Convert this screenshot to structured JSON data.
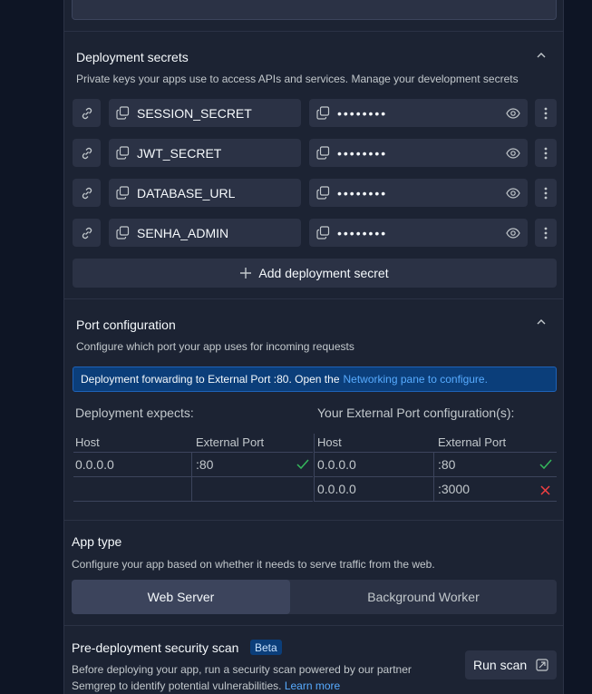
{
  "secrets": {
    "title": "Deployment secrets",
    "subtitle": "Private keys your apps use to access APIs and services. Manage your development secrets",
    "rows": [
      {
        "key": "SESSION_SECRET",
        "value": "••••••••"
      },
      {
        "key": "JWT_SECRET",
        "value": "••••••••"
      },
      {
        "key": "DATABASE_URL",
        "value": "••••••••"
      },
      {
        "key": "SENHA_ADMIN",
        "value": "••••••••"
      }
    ],
    "add_label": "Add deployment secret"
  },
  "ports": {
    "title": "Port configuration",
    "subtitle": "Configure which port your app uses for incoming requests",
    "banner_text": "Deployment forwarding to External Port :80. Open the",
    "banner_link": "Networking pane to configure.",
    "expects_label": "Deployment expects:",
    "external_label": "Your External Port configuration(s):",
    "col_host": "Host",
    "col_external": "External Port",
    "expects_rows": [
      {
        "host": "0.0.0.0",
        "port": ":80",
        "status": "ok"
      }
    ],
    "external_rows": [
      {
        "host": "0.0.0.0",
        "port": ":80",
        "status": "ok"
      },
      {
        "host": "0.0.0.0",
        "port": ":3000",
        "status": "error"
      }
    ]
  },
  "app_type": {
    "title": "App type",
    "subtitle": "Configure your app based on whether it needs to serve traffic from the web.",
    "options": [
      "Web Server",
      "Background Worker"
    ],
    "selected": "Web Server"
  },
  "scan": {
    "title": "Pre-deployment security scan",
    "badge": "Beta",
    "desc_line1": "Before deploying your app, run a security scan powered by our partner",
    "desc_line2": "Semgrep to identify potential vulnerabilities.",
    "learn_more": "Learn more",
    "run_label": "Run scan"
  },
  "colors": {
    "ok": "#35b85c",
    "error": "#f23f42",
    "link": "#57abff"
  }
}
